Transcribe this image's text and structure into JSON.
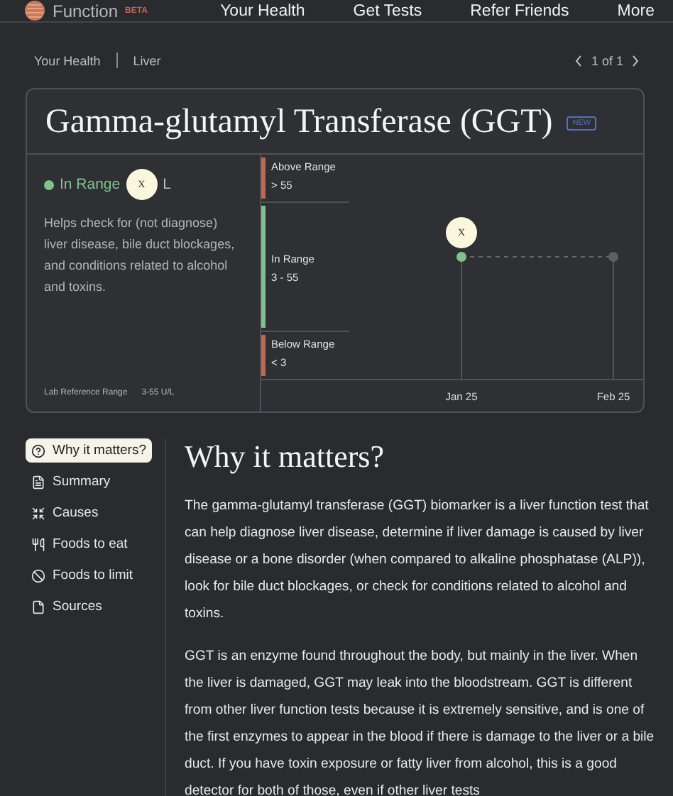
{
  "nav": {
    "brand": "Function",
    "badge": "BETA",
    "links": [
      {
        "label": "Your Health"
      },
      {
        "label": "Get Tests"
      },
      {
        "label": "Refer Friends"
      },
      {
        "label": "More"
      }
    ]
  },
  "breadcrumb": {
    "items": [
      "Your Health",
      "Liver"
    ],
    "pager": "1 of 1"
  },
  "card": {
    "title": "Gamma-glutamyl Transferase (GGT)",
    "badge": "NEW",
    "status": {
      "label": "In Range",
      "color": "#7fc28a",
      "marker": "X",
      "suffix": "L"
    },
    "description": "Helps check for (not diagnose) liver disease, bile duct blockages, and conditions related to alcohol and toxins.",
    "reference": {
      "label": "Lab Reference Range",
      "value": "3-55 U/L"
    },
    "ranges": [
      {
        "name": "Above Range",
        "value": "> 55",
        "color": "#c0674f"
      },
      {
        "name": "In Range",
        "value": "3 - 55",
        "color": "#7fc28a"
      },
      {
        "name": "Below Range",
        "value": "< 3",
        "color": "#c0674f"
      }
    ],
    "points": [
      {
        "date": "Jan 25",
        "color": "#7fc28a",
        "marker": "X"
      },
      {
        "date": "Feb 25",
        "color": "#5e5f63"
      }
    ]
  },
  "sidebar": {
    "items": [
      {
        "label": "Why it matters?",
        "selected": true
      },
      {
        "label": "Summary",
        "selected": false
      },
      {
        "label": "Causes",
        "selected": false
      },
      {
        "label": "Foods to eat",
        "selected": false
      },
      {
        "label": "Foods to limit",
        "selected": false
      },
      {
        "label": "Sources",
        "selected": false
      }
    ]
  },
  "content": {
    "heading": "Why it matters?",
    "paragraphs": [
      "The gamma-glutamyl transferase (GGT) biomarker is a liver function test that can help diagnose liver disease, determine if liver damage is caused by liver disease or a bone disorder (when compared to alkaline phosphatase (ALP)), look for bile duct blockages, or check for conditions related to alcohol and toxins.",
      "GGT is an enzyme found throughout the body, but mainly in the liver. When the liver is damaged, GGT may leak into the bloodstream. GGT is different from other liver function tests because it is extremely sensitive, and is one of the first enzymes to appear in the blood if there is damage to the liver or a bile duct. If you have toxin exposure or fatty liver from alcohol, this is a good detector for both of those, even if other liver tests"
    ]
  }
}
